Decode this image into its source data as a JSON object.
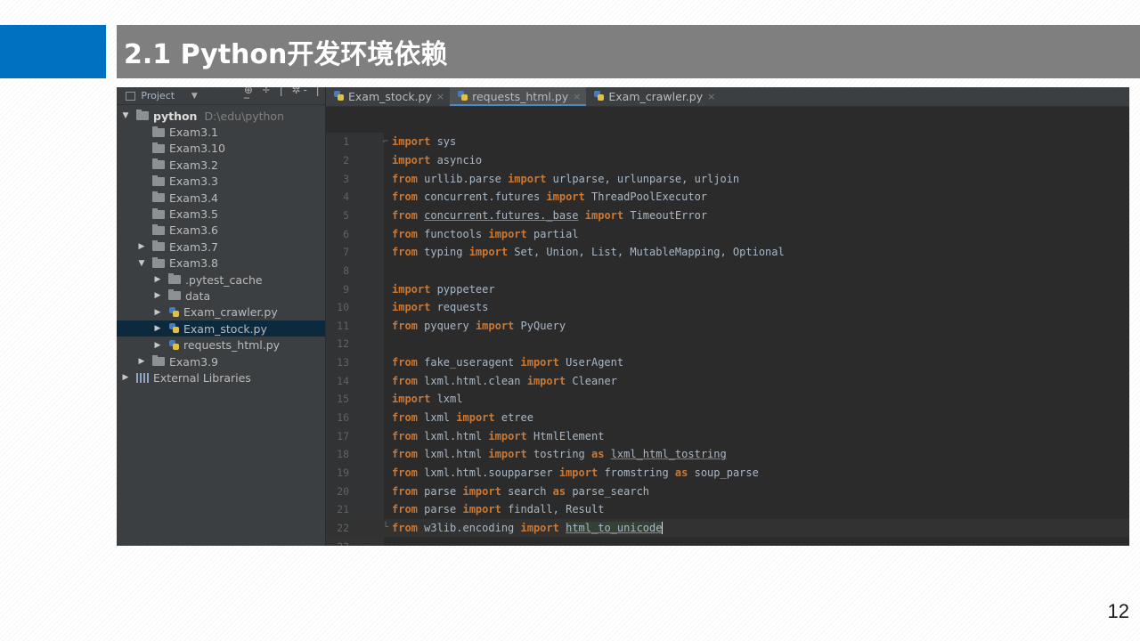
{
  "slide": {
    "title": "2.1 Python开发环境依赖",
    "page_number": "12",
    "accent_color": "#0070c0",
    "title_bar_color": "#7f7f7f"
  },
  "project_panel": {
    "header_label": "Project",
    "root_name": "python",
    "root_path": "D:\\edu\\python",
    "items": [
      {
        "label": "Exam3.1",
        "type": "folder",
        "expandable": false
      },
      {
        "label": "Exam3.10",
        "type": "folder",
        "expandable": false
      },
      {
        "label": "Exam3.2",
        "type": "folder",
        "expandable": false
      },
      {
        "label": "Exam3.3",
        "type": "folder",
        "expandable": false
      },
      {
        "label": "Exam3.4",
        "type": "folder",
        "expandable": false
      },
      {
        "label": "Exam3.5",
        "type": "folder",
        "expandable": false
      },
      {
        "label": "Exam3.6",
        "type": "folder",
        "expandable": false
      },
      {
        "label": "Exam3.7",
        "type": "folder",
        "expandable": true
      },
      {
        "label": "Exam3.8",
        "type": "folder",
        "expanded": true
      },
      {
        "label": ".pytest_cache",
        "type": "folder",
        "child": true
      },
      {
        "label": "data",
        "type": "folder",
        "child": true
      },
      {
        "label": "Exam_crawler.py",
        "type": "python-file",
        "child": true
      },
      {
        "label": "Exam_stock.py",
        "type": "python-file",
        "child": true,
        "selected": true
      },
      {
        "label": "requests_html.py",
        "type": "python-file",
        "child": true
      },
      {
        "label": "Exam3.9",
        "type": "folder",
        "expandable": true
      },
      {
        "label": "External Libraries",
        "type": "libraries",
        "expandable": true
      }
    ]
  },
  "editor": {
    "tabs": [
      {
        "label": "Exam_stock.py",
        "active": false
      },
      {
        "label": "requests_html.py",
        "active": true
      },
      {
        "label": "Exam_crawler.py",
        "active": false
      }
    ],
    "code_lines": [
      "import sys",
      "import asyncio",
      "from urllib.parse import urlparse, urlunparse, urljoin",
      "from concurrent.futures import ThreadPoolExecutor",
      "from concurrent.futures._base import TimeoutError",
      "from functools import partial",
      "from typing import Set, Union, List, MutableMapping, Optional",
      "",
      "import pyppeteer",
      "import requests",
      "from pyquery import PyQuery",
      "",
      "from fake_useragent import UserAgent",
      "from lxml.html.clean import Cleaner",
      "import lxml",
      "from lxml import etree",
      "from lxml.html import HtmlElement",
      "from lxml.html import tostring as lxml_html_tostring",
      "from lxml.html.soupparser import fromstring as soup_parse",
      "from parse import search as parse_search",
      "from parse import findall, Result",
      "from w3lib.encoding import html_to_unicode",
      ""
    ],
    "current_line": 22,
    "keyword_color": "#cc7832",
    "text_color": "#a9b7c6"
  }
}
